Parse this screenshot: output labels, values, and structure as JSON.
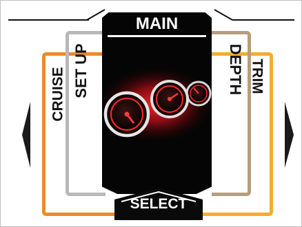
{
  "menu": {
    "center": {
      "label": "MAIN",
      "icon": "gauges-icon"
    },
    "select": {
      "label": "SELECT"
    },
    "left": [
      {
        "label": "SET UP",
        "color": "#b8b8b8"
      },
      {
        "label": "CRUISE",
        "color": "#eb8a2c"
      }
    ],
    "right": [
      {
        "label": "DEPTH",
        "color": "#b79d7d"
      },
      {
        "label": "TRIM",
        "color": "#f2ae2c"
      }
    ]
  },
  "colors": {
    "panel": "#050505",
    "glow": "#e0191f",
    "arrow": "#1a1a1a"
  }
}
